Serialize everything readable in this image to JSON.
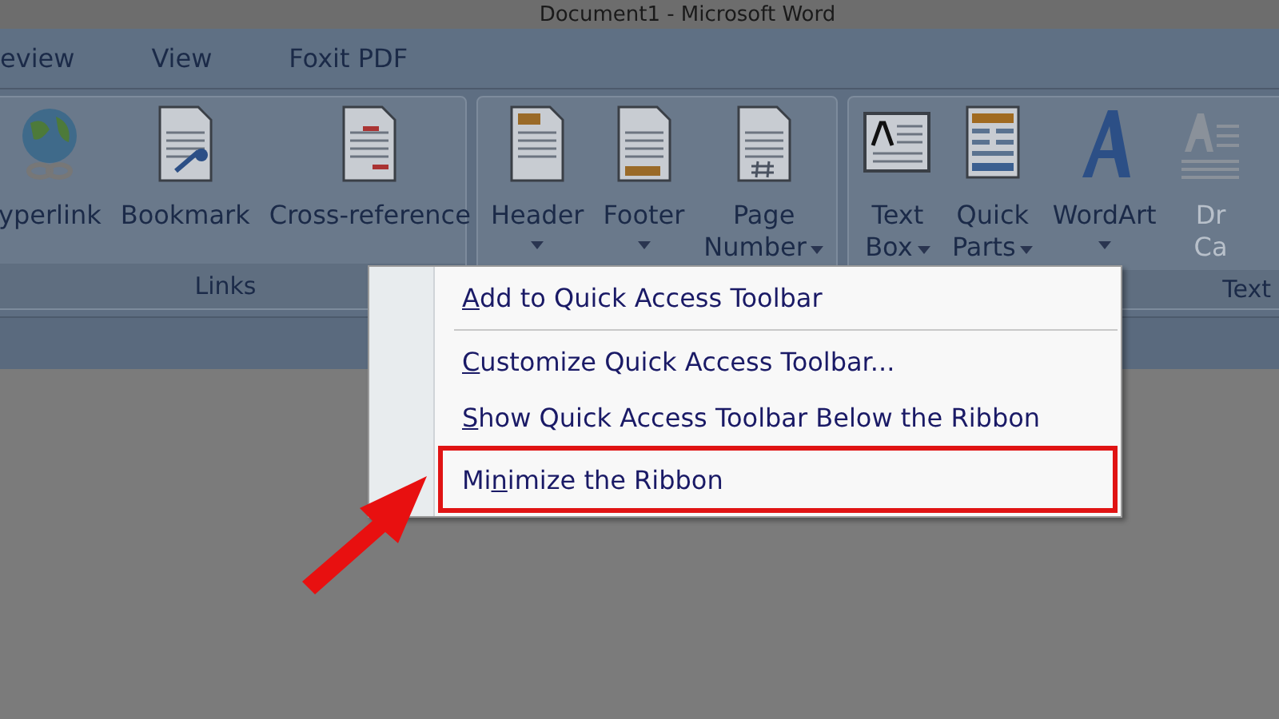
{
  "window": {
    "title": "Document1 - Microsoft Word"
  },
  "tabs": [
    {
      "label": "eview",
      "selected": false
    },
    {
      "label": "View",
      "selected": false
    },
    {
      "label": "Foxit PDF",
      "selected": false
    }
  ],
  "ribbon_groups": [
    {
      "label": "Links",
      "buttons": [
        {
          "kind": "globe",
          "lines": [
            "yperlink"
          ],
          "dropdown": false,
          "disabled": false
        },
        {
          "kind": "bookmark",
          "lines": [
            "Bookmark"
          ],
          "dropdown": false,
          "disabled": false
        },
        {
          "kind": "crossref",
          "lines": [
            "Cross-reference"
          ],
          "dropdown": false,
          "disabled": false
        }
      ]
    },
    {
      "buttons": [
        {
          "kind": "header",
          "lines": [
            "Header"
          ],
          "dropdown": true,
          "disabled": false
        },
        {
          "kind": "footer",
          "lines": [
            "Footer"
          ],
          "dropdown": true,
          "disabled": false
        },
        {
          "kind": "pagenumber",
          "lines": [
            "Page",
            "Number"
          ],
          "dropdown": true,
          "disabled": false
        }
      ]
    },
    {
      "label": "Text",
      "buttons": [
        {
          "kind": "textbox",
          "lines": [
            "Text",
            "Box"
          ],
          "dropdown": true,
          "disabled": false
        },
        {
          "kind": "quickparts",
          "lines": [
            "Quick",
            "Parts"
          ],
          "dropdown": true,
          "disabled": false
        },
        {
          "kind": "wordart",
          "lines": [
            "WordArt"
          ],
          "dropdown": true,
          "disabled": false
        },
        {
          "kind": "dropcap",
          "lines": [
            "Dr",
            "Ca"
          ],
          "dropdown": false,
          "disabled": true
        }
      ]
    }
  ],
  "context_menu": {
    "items": [
      {
        "key": "A",
        "after": "dd to Quick Access Toolbar",
        "separator_after": true,
        "highlighted": false
      },
      {
        "key": "C",
        "after": "ustomize Quick Access Toolbar...",
        "separator_after": false,
        "highlighted": false
      },
      {
        "key": "S",
        "after": "how Quick Access Toolbar Below the Ribbon",
        "separator_after": false,
        "highlighted": false
      },
      {
        "before": "Mi",
        "key": "n",
        "after": "imize the Ribbon",
        "separator_after": false,
        "highlighted": true
      }
    ]
  }
}
